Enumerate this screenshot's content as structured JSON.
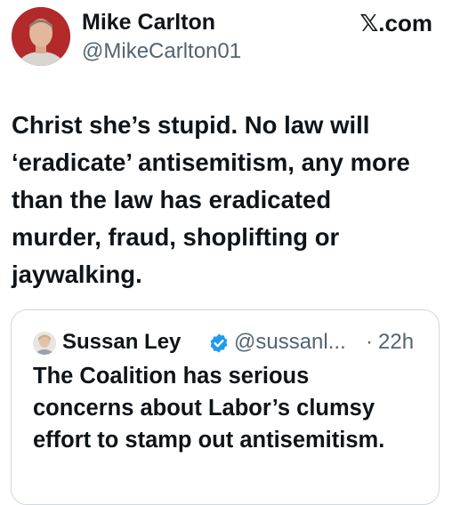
{
  "author": {
    "name": "Mike Carlton",
    "handle": "@MikeCarlton01"
  },
  "source_label": "𝕏.com",
  "tweet_lines": [
    "Christ she’s stupid. No law will",
    "‘eradicate’ antisemitism, any more",
    "than the law has eradicated",
    "murder, fraud, shoplifting or",
    "jaywalking."
  ],
  "quoted": {
    "name": "Sussan Ley",
    "handle": "@sussanl...",
    "separator": "·",
    "time": "22h",
    "verified_icon": "verified-badge-icon",
    "text_lines": [
      "The Coalition has serious",
      "concerns about Labor’s clumsy",
      "effort to stamp out antisemitism."
    ]
  },
  "colors": {
    "text": "#0f1419",
    "secondary_text": "#536471",
    "verified_blue": "#1d9bf0",
    "card_border": "#cfd9de",
    "avatar_bg": "#b32a2a"
  }
}
